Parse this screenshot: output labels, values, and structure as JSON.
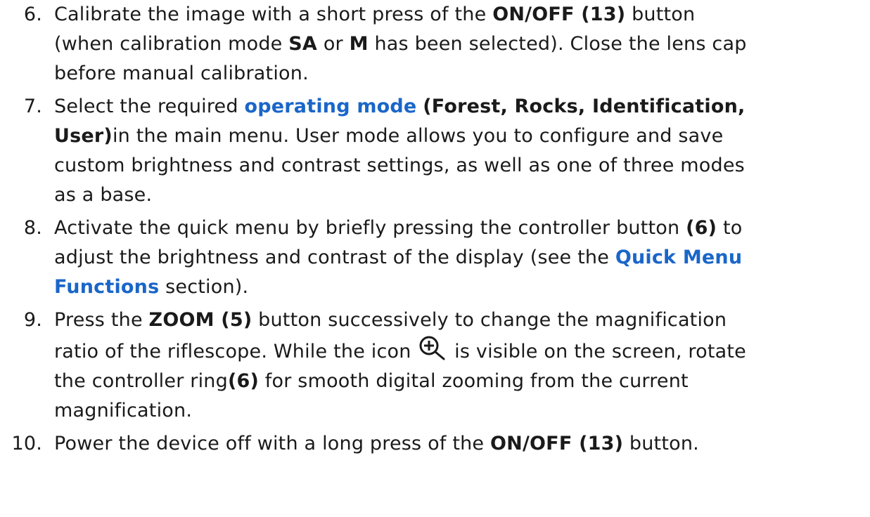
{
  "steps": [
    {
      "number": "6.",
      "lines": [
        [
          "Calibrate the image with a short press of the ",
          {
            "b": "ON/OFF (13)"
          },
          " button"
        ],
        [
          "(when calibration mode ",
          {
            "b": "SA"
          },
          " or ",
          {
            "b": "M"
          },
          " has been selected). Close the lens cap"
        ],
        [
          "before manual calibration."
        ]
      ]
    },
    {
      "number": "7.",
      "lines": [
        [
          "Select the required ",
          {
            "link": "operating mode"
          },
          " ",
          {
            "b": "(Forest, Rocks, Identification,"
          }
        ],
        [
          {
            "b": "User)"
          },
          "in the main menu. User mode allows you to configure and save"
        ],
        [
          "custom brightness and contrast settings, as well as one of three modes"
        ],
        [
          "as a base."
        ]
      ]
    },
    {
      "number": "8.",
      "lines": [
        [
          "Activate the quick menu by briefly pressing the controller button ",
          {
            "b": "(6)"
          },
          " to"
        ],
        [
          "adjust the brightness and contrast of the display (see the ",
          {
            "link": "Quick Menu"
          }
        ],
        [
          {
            "link": "Functions"
          },
          " section)."
        ]
      ]
    },
    {
      "number": "9.",
      "lines": [
        [
          "Press the ",
          {
            "b": "ZOOM (5)"
          },
          " button successively to change the magnification"
        ],
        [
          "ratio of the riflescope. While the icon ",
          {
            "icon": "zoom-in-icon"
          },
          " is visible on the screen, rotate"
        ],
        [
          "the controller ring",
          {
            "b": "(6)"
          },
          " for smooth digital zooming from the current"
        ],
        [
          "magnification."
        ]
      ]
    },
    {
      "number": "10.",
      "lines": [
        [
          "Power the device off with a long press of the ",
          {
            "b": "ON/OFF (13)"
          },
          " button."
        ]
      ]
    }
  ],
  "colors": {
    "text": "#1a1a1a",
    "link": "#1a66c9"
  }
}
